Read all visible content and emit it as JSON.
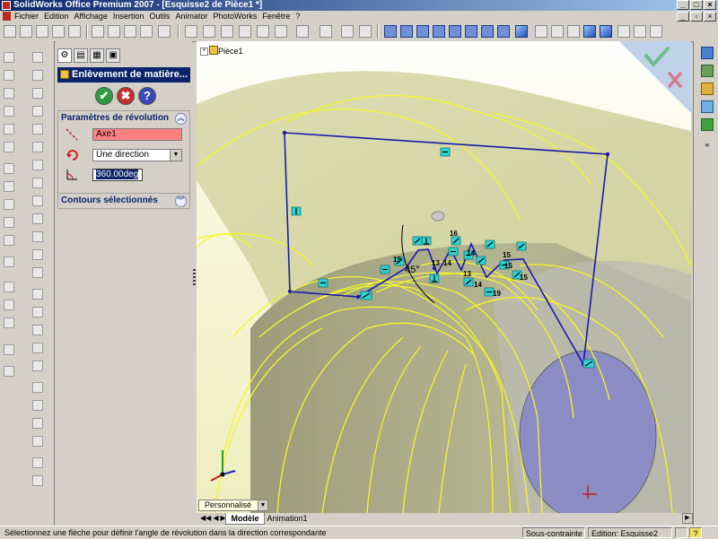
{
  "window": {
    "title": "SolidWorks Office Premium 2007 - [Esquisse2 de Pièce1 *]"
  },
  "menu": {
    "items": [
      "Fichier",
      "Edition",
      "Affichage",
      "Insertion",
      "Outils",
      "Animator",
      "PhotoWorks",
      "Fenêtre",
      "?"
    ]
  },
  "property_manager": {
    "title": "Enlèvement de matière...",
    "ok_icon": "check-icon",
    "cancel_icon": "x-icon",
    "help_label": "?",
    "revolution_group": {
      "title": "Paramètres de révolution",
      "axis_value": "Axe1",
      "direction_value": "Une direction",
      "angle_value": "360.00deg"
    },
    "contours_group": {
      "title": "Contours sélectionnés"
    }
  },
  "graphics": {
    "tree_label": "Pièce1",
    "angle_label": "45°",
    "colors": {
      "background": "#eeeec0",
      "sketch_line": "#1a1aa8",
      "edge_yellow": "#f5f52a",
      "confirm_check": "#6abf8a",
      "cancel_x": "#d87a8e",
      "relation_badge": "#2dd4d4"
    },
    "relation_labels": [
      "16",
      "14",
      "19",
      "13",
      "14",
      "15",
      "13",
      "14",
      "15",
      "15",
      "19"
    ]
  },
  "tabs": {
    "custom_label": "Personnalisé",
    "items": [
      "Modèle",
      "Animation1"
    ]
  },
  "status": {
    "message": "Sélectionnez une flèche pour définir l'angle de révolution dans la direction correspondante",
    "sketch_state": "Sous-contrainte",
    "edit_state": "Edition: Esquisse2",
    "help": "?"
  }
}
